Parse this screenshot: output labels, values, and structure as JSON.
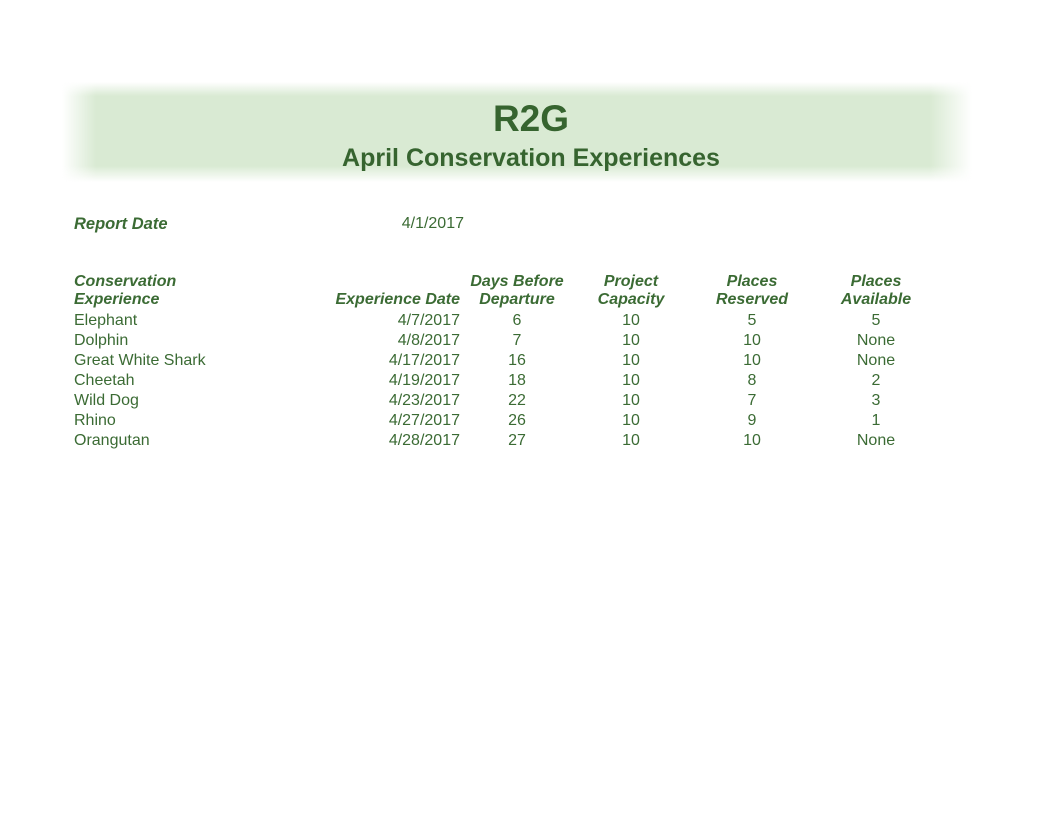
{
  "header": {
    "title": "R2G",
    "subtitle": "April Conservation Experiences",
    "band_color": "#d9ead3",
    "text_color": "#36642f"
  },
  "report_date": {
    "label": "Report Date",
    "value": "4/1/2017"
  },
  "table": {
    "columns": [
      {
        "key": "experience",
        "label": "Conservation Experience",
        "align": "left"
      },
      {
        "key": "date",
        "label": "Experience Date",
        "align": "right"
      },
      {
        "key": "days_before",
        "label": "Days Before Departure",
        "align": "center"
      },
      {
        "key": "capacity",
        "label": "Project Capacity",
        "align": "center"
      },
      {
        "key": "reserved",
        "label": "Places Reserved",
        "align": "center"
      },
      {
        "key": "available",
        "label": "Places Available",
        "align": "center"
      }
    ],
    "header_lines": {
      "experience": [
        "Conservation",
        "Experience"
      ],
      "date": [
        "",
        "Experience Date"
      ],
      "days_before": [
        "Days Before",
        "Departure"
      ],
      "capacity": [
        "Project",
        "Capacity"
      ],
      "reserved": [
        "Places",
        "Reserved"
      ],
      "available": [
        "Places",
        "Available"
      ]
    },
    "rows": [
      {
        "experience": "Elephant",
        "date": "4/7/2017",
        "days_before": "6",
        "capacity": "10",
        "reserved": "5",
        "available": "5"
      },
      {
        "experience": "Dolphin",
        "date": "4/8/2017",
        "days_before": "7",
        "capacity": "10",
        "reserved": "10",
        "available": "None"
      },
      {
        "experience": "Great White Shark",
        "date": "4/17/2017",
        "days_before": "16",
        "capacity": "10",
        "reserved": "10",
        "available": "None"
      },
      {
        "experience": "Cheetah",
        "date": "4/19/2017",
        "days_before": "18",
        "capacity": "10",
        "reserved": "8",
        "available": "2"
      },
      {
        "experience": "Wild Dog",
        "date": "4/23/2017",
        "days_before": "22",
        "capacity": "10",
        "reserved": "7",
        "available": "3"
      },
      {
        "experience": "Rhino",
        "date": "4/27/2017",
        "days_before": "26",
        "capacity": "10",
        "reserved": "9",
        "available": "1"
      },
      {
        "experience": "Orangutan",
        "date": "4/28/2017",
        "days_before": "27",
        "capacity": "10",
        "reserved": "10",
        "available": "None"
      }
    ]
  }
}
